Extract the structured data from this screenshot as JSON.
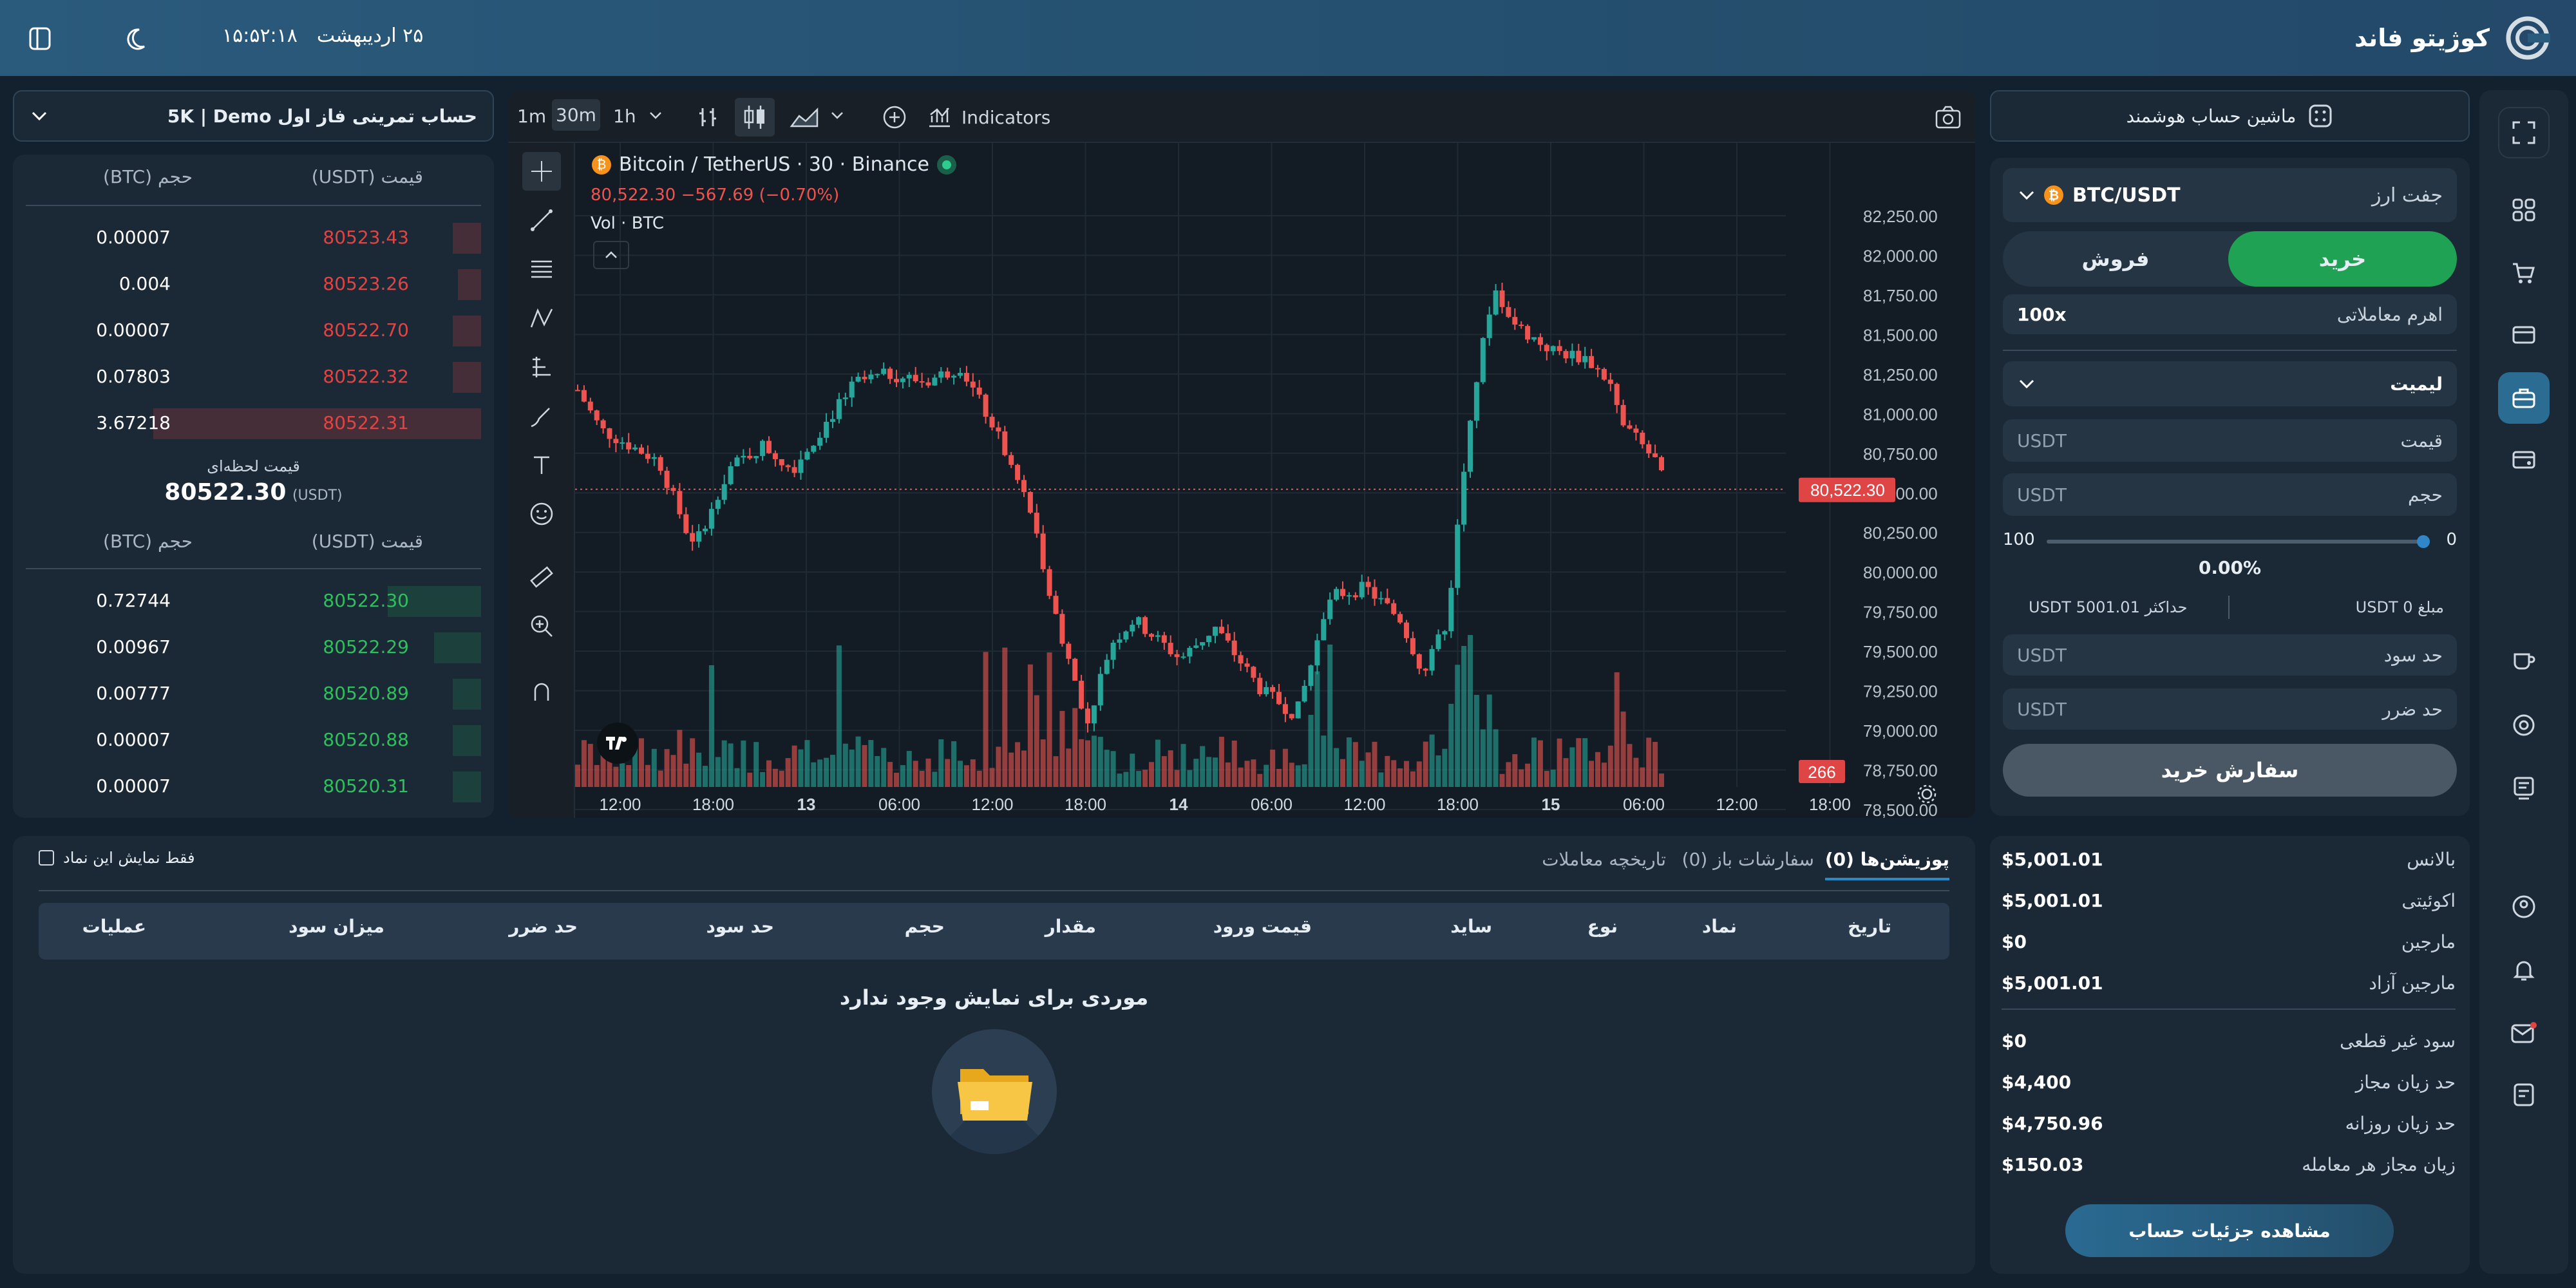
{
  "header": {
    "brand": "کوژیتو فاند",
    "date": "۲۵ اردیبهشت",
    "time": "۱۵:۵۲:۱۸"
  },
  "account_select": {
    "label": "حساب تمرینی فاز اول 5K | Demo"
  },
  "smart_account": {
    "label": "ماشین حساب هوشمند"
  },
  "chart_toolbar": {
    "intervals": [
      "1m",
      "30m",
      "1h"
    ],
    "active_interval": "30m",
    "indicators_label": "Indicators"
  },
  "chart": {
    "symbol_line": "Bitcoin / TetherUS · 30 · Binance",
    "price_change": "80,522.30  −567.69 (−0.70%)",
    "volume_label": "Vol · BTC",
    "last_price_tag": "80,522.30",
    "volume_tag": "266",
    "y_ticks": [
      "82,250.00",
      "82,000.00",
      "81,750.00",
      "81,500.00",
      "81,250.00",
      "81,000.00",
      "80,750.00",
      "80,500.00",
      "80,250.00",
      "80,000.00",
      "79,750.00",
      "79,500.00",
      "79,250.00",
      "79,000.00",
      "78,750.00",
      "78,500.00"
    ],
    "x_ticks": [
      "12:00",
      "18:00",
      "13",
      "06:00",
      "12:00",
      "18:00",
      "14",
      "06:00",
      "12:00",
      "18:00",
      "15",
      "06:00",
      "12:00",
      "18:00"
    ]
  },
  "chart_data": {
    "type": "candlestick",
    "title": "Bitcoin / TetherUS · 30 · Binance",
    "ylim": [
      78500,
      82250
    ],
    "last_price": 80522.3,
    "change": -567.69,
    "change_pct": -0.7,
    "series": [
      {
        "name": "Vol · BTC",
        "type": "bar",
        "note": "volume bars under price"
      }
    ],
    "colors": {
      "up": "#26a69a",
      "down": "#ef5350"
    }
  },
  "orderbook": {
    "head_price": "قیمت (USDT)",
    "head_qty": "حجم (BTC)",
    "asks": [
      {
        "price": "80523.43",
        "qty": "0.00007",
        "depth": 0.06
      },
      {
        "price": "80523.26",
        "qty": "0.004",
        "depth": 0.05
      },
      {
        "price": "80522.70",
        "qty": "0.00007",
        "depth": 0.06
      },
      {
        "price": "80522.32",
        "qty": "0.07803",
        "depth": 0.06
      },
      {
        "price": "80522.31",
        "qty": "3.67218",
        "depth": 0.7
      }
    ],
    "live_label": "قیمت لحظه‌ای",
    "live_price": "80522.30",
    "live_unit": "(USDT)",
    "bids": [
      {
        "price": "80522.30",
        "qty": "0.72744",
        "depth": 0.2
      },
      {
        "price": "80522.29",
        "qty": "0.00967",
        "depth": 0.1
      },
      {
        "price": "80520.89",
        "qty": "0.00777",
        "depth": 0.06
      },
      {
        "price": "80520.88",
        "qty": "0.00007",
        "depth": 0.06
      },
      {
        "price": "80520.31",
        "qty": "0.00007",
        "depth": 0.06
      }
    ]
  },
  "order_form": {
    "pair_label": "جفت ارز",
    "pair": "BTC/USDT",
    "buy": "خرید",
    "sell": "فروش",
    "leverage_label": "اهرم معاملاتی",
    "leverage": "100x",
    "order_type": "لیمیت",
    "price_label": "قیمت",
    "volume_label": "حجم",
    "unit": "USDT",
    "slider_min": "0",
    "slider_max": "100",
    "slider_pct": "0.00%",
    "amount": "مبلغ 0 USDT",
    "max": "حداکثر 5001.01 USDT",
    "tp_label": "حد سود",
    "sl_label": "حد ضرر",
    "submit": "سفارش خرید"
  },
  "summary": {
    "rows": [
      {
        "label": "بالانس",
        "value": "$5,001.01"
      },
      {
        "label": "اکوئیتی",
        "value": "$5,001.01"
      },
      {
        "label": "مارجین",
        "value": "$0"
      },
      {
        "label": "مارجین آزاد",
        "value": "$5,001.01"
      },
      {
        "label": "سود غیر قطعی",
        "value": "$0"
      },
      {
        "label": "حد زیان مجاز",
        "value": "$4,400"
      },
      {
        "label": "حد زیان روزانه",
        "value": "$4,750.96"
      },
      {
        "label": "زیان مجاز هر معامله",
        "value": "$150.03"
      }
    ],
    "details_button": "مشاهده جزئیات حساب"
  },
  "positions": {
    "tabs": [
      "پوزیشن‌ها (0)",
      "سفارشات باز (0)",
      "تاریخچه معاملات"
    ],
    "filter_label": "فقط نمایش این نماد",
    "columns": [
      "تاریخ",
      "نماد",
      "نوع",
      "ساید",
      "قیمت ورود",
      "مقدار",
      "حجم",
      "حد سود",
      "حد ضرر",
      "میزان سود",
      "عملیات"
    ],
    "empty": "موردی برای نمایش وجود ندارد"
  },
  "colors": {
    "bg": "#13212e",
    "panel": "#1b2835",
    "green": "#1f9d55",
    "red": "#e04545",
    "accent": "#2b6c93"
  }
}
